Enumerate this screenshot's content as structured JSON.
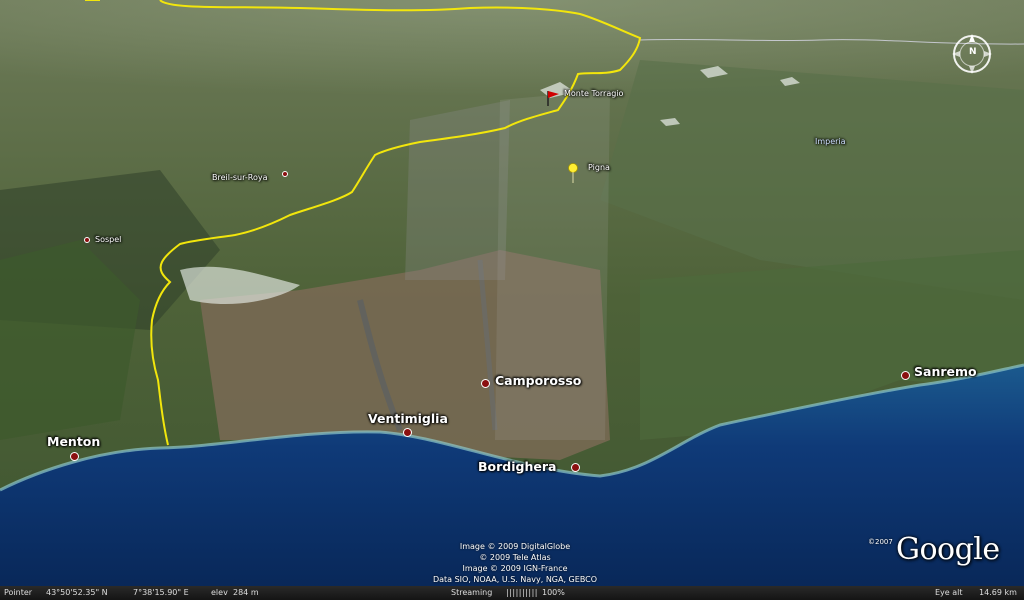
{
  "places": {
    "monte_torragio": "Monte Torragio",
    "pigna": "Pigna",
    "imperia": "Imperia",
    "breil": "Breil-sur-Roya",
    "sospel": "Sospel",
    "camporosso": "Camporosso",
    "ventimiglia": "Ventimiglia",
    "menton": "Menton",
    "bordighera": "Bordighera",
    "sanremo": "Sanremo"
  },
  "attribution": {
    "line1": "Image © 2009 DigitalGlobe",
    "line2": "© 2009 Tele Atlas",
    "line3": "Image © 2009 IGN-France",
    "line4": "Data SIO, NOAA, U.S. Navy, NGA, GEBCO"
  },
  "logo": {
    "copyright": "©2007",
    "text": "Google"
  },
  "compass": {
    "north": "N"
  },
  "status": {
    "pointer_label": "Pointer",
    "latitude": "43°50'52.35\" N",
    "longitude": "7°38'15.90\" E",
    "elev_label": "elev",
    "elevation": "284 m",
    "streaming_label": "Streaming",
    "streaming_bar": "||||||||||",
    "streaming_percent": "100%",
    "eye_label": "Eye alt",
    "eye_altitude": "14.69 km"
  },
  "colors": {
    "border": "#ffee00",
    "sea": "#0c2f6e",
    "pin": "#8b1010",
    "flag": "#d00000",
    "pushpin": "#ffee33"
  },
  "icons": {
    "summit": "red-flag-icon",
    "town_marker": "yellow-pushpin-icon",
    "compass": "compass-rose-icon"
  }
}
